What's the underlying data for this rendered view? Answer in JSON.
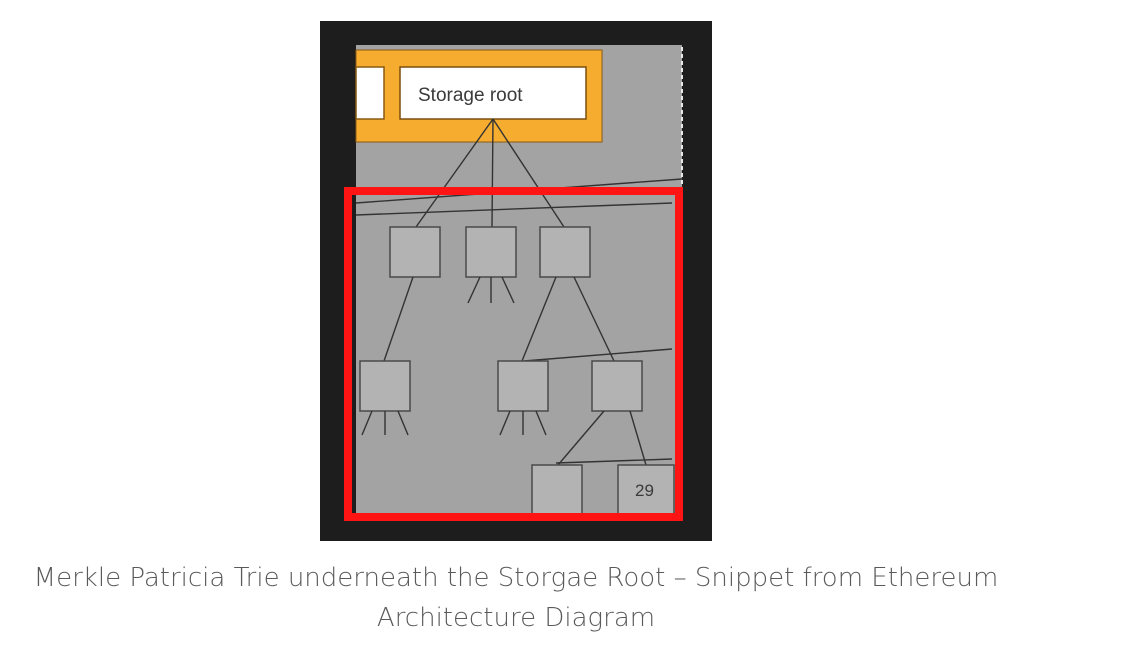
{
  "diagram": {
    "storage_root_label": "Storage root",
    "leaf_node_label": "29",
    "colors": {
      "frame": "#1d1d1d",
      "canvas": "#a3a3a3",
      "account_band": "#f6ad2f",
      "node_fill": "#b3b3b3",
      "node_border": "#4a4a4a",
      "highlight": "#ff1414",
      "edge": "#333333"
    }
  },
  "caption": {
    "line1": "Merkle Patricia Trie underneath the Storgae Root – Snippet from Ethereum",
    "line2": "Architecture Diagram"
  }
}
